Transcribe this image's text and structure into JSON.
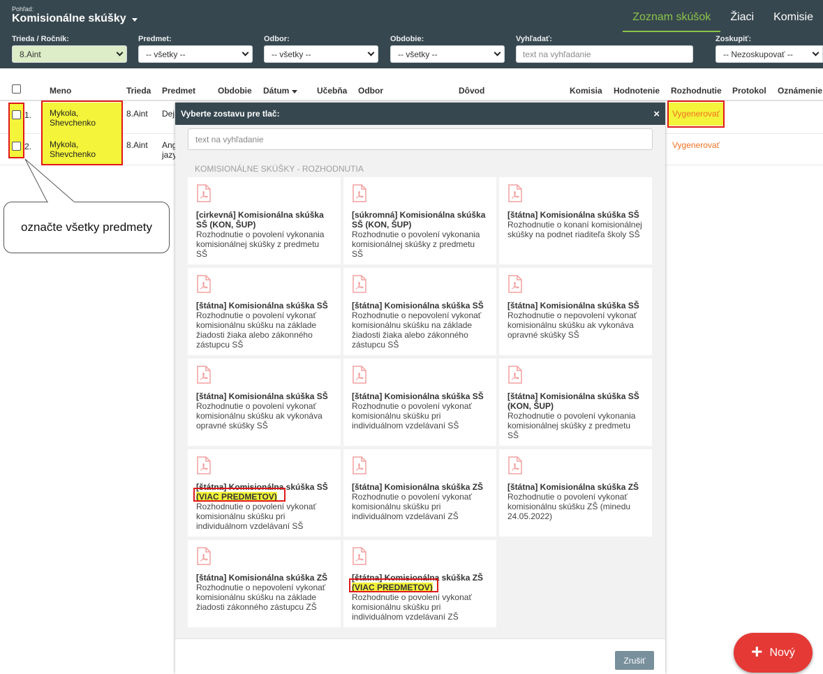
{
  "header": {
    "view_caption": "Pohľad:",
    "view_title": "Komisionálne skúšky",
    "nav": [
      "Zoznam skúšok",
      "Žiaci",
      "Komisie"
    ]
  },
  "filters": {
    "class": {
      "label": "Trieda / Ročník:",
      "value": "8.Aint"
    },
    "subject": {
      "label": "Predmet:",
      "value": "-- všetky --"
    },
    "field": {
      "label": "Odbor:",
      "value": "-- všetky --"
    },
    "period": {
      "label": "Obdobie:",
      "value": "-- všetky --"
    },
    "search": {
      "label": "Vyhľadať:",
      "placeholder": "text na vyhľadanie"
    },
    "group": {
      "label": "Zoskupiť:",
      "value": "-- Nezoskupovať --"
    }
  },
  "table": {
    "columns": [
      "Meno",
      "Trieda",
      "Predmet",
      "Obdobie",
      "Dátum",
      "Učebňa",
      "Odbor",
      "Dôvod",
      "Komisia",
      "Hodnotenie",
      "Rozhodnutie",
      "Protokol",
      "Oznámenie"
    ],
    "rows": [
      {
        "num": "1.",
        "name1": "Mykola,",
        "name2": "Shevchenko",
        "class": "8.Aint",
        "subject1": "Dej",
        "subject2": "",
        "decision": "Vygenerovať"
      },
      {
        "num": "2.",
        "name1": "Mykola,",
        "name2": "Shevchenko",
        "class": "8.Aint",
        "subject1": "Ang",
        "subject2": "jazy",
        "decision": "Vygenerovať"
      }
    ]
  },
  "callout": "označte všetky predmety",
  "modal": {
    "title": "Vyberte zostavu pre tlač:",
    "close": "×",
    "search_placeholder": "text na vyhľadanie",
    "section": "KOMISIONÁLNE SKÚŠKY - ROZHODNUTIA",
    "cards": [
      {
        "title": "[cirkevná] Komisionálna skúška SŠ (KON, ŠUP)",
        "tag": "",
        "desc": "Rozhodnutie o povolení vykonania komisionálnej skúšky z predmetu SŠ"
      },
      {
        "title": "[súkromná] Komisionálna skúška SŠ (KON, ŠUP)",
        "tag": "",
        "desc": "Rozhodnutie o povolení vykonania komisionálnej skúšky z predmetu SŠ"
      },
      {
        "title": "[štátna] Komisionálna skúška SŠ",
        "tag": "",
        "desc": "Rozhodnutie o konaní komisionálnej skúšky na podnet riaditeľa školy SŠ"
      },
      {
        "title": "[štátna] Komisionálna skúška SŠ",
        "tag": "",
        "desc": "Rozhodnutie o povolení vykonať komisionálnu skúšku na základe žiadosti žiaka alebo zákonného zástupcu SŠ"
      },
      {
        "title": "[štátna] Komisionálna skúška SŠ",
        "tag": "",
        "desc": "Rozhodnutie o nepovolení vykonať komisionálnu skúšku na základe žiadosti žiaka alebo zákonného zástupcu SŠ"
      },
      {
        "title": "[štátna] Komisionálna skúška SŠ",
        "tag": "",
        "desc": "Rozhodnutie o nepovolení vykonať komisionálnu skúšku ak vykonáva opravné skúšky SŠ"
      },
      {
        "title": "[štátna] Komisionálna skúška SŠ",
        "tag": "",
        "desc": "Rozhodnutie o povolení vykonať komisionálnu skúšku ak vykonáva opravné skúšky SŠ"
      },
      {
        "title": "[štátna] Komisionálna skúška SŠ",
        "tag": "",
        "desc": "Rozhodnutie o povolení vykonať komisionálnu skúšku pri individuálnom vzdelávaní SŠ"
      },
      {
        "title": "[štátna] Komisionálna skúška SŠ (KON, ŠUP)",
        "tag": "",
        "desc": "Rozhodnutie o povolení vykonania komisionálnej skúšky z predmetu SŠ"
      },
      {
        "title": "[štátna] Komisionálna skúška SŠ",
        "tag": "(VIAC PREDMETOV)",
        "desc": "Rozhodnutie o povolení vykonať komisionálnu skúšku pri individuálnom vzdelávaní SŠ"
      },
      {
        "title": "[štátna] Komisionálna skúška ZŠ",
        "tag": "",
        "desc": "Rozhodnutie o povolení vykonať komisionálnu skúšku pri individuálnom vzdelávaní ZŠ"
      },
      {
        "title": "[štátna] Komisionálna skúška ZŠ",
        "tag": "",
        "desc": "Rozhodnutie o povolení vykonať komisionálnu skúšku ZŠ (minedu 24.05.2022)"
      },
      {
        "title": "[štátna] Komisionálna skúška ZŠ",
        "tag": "",
        "desc": "Rozhodnutie o nepovolení vykonať komisionálnu skúšku na základe žiadosti zákonného zástupcu ZŠ"
      },
      {
        "title": "[štátna] Komisionálna skúška ZŠ",
        "tag": "(VIAC PREDMETOV)",
        "desc": "Rozhodnutie o povolení vykonať komisionálnu skúšku pri individuálnom vzdelávaní ZŠ"
      }
    ],
    "cancel": "Zrušiť"
  },
  "fab": {
    "icon": "+",
    "label": "Nový"
  },
  "colors": {
    "header": "#37474f",
    "accent": "#8bc34a",
    "highlight": "#f4f43a",
    "annotation": "#e01818",
    "fab": "#e53935"
  }
}
